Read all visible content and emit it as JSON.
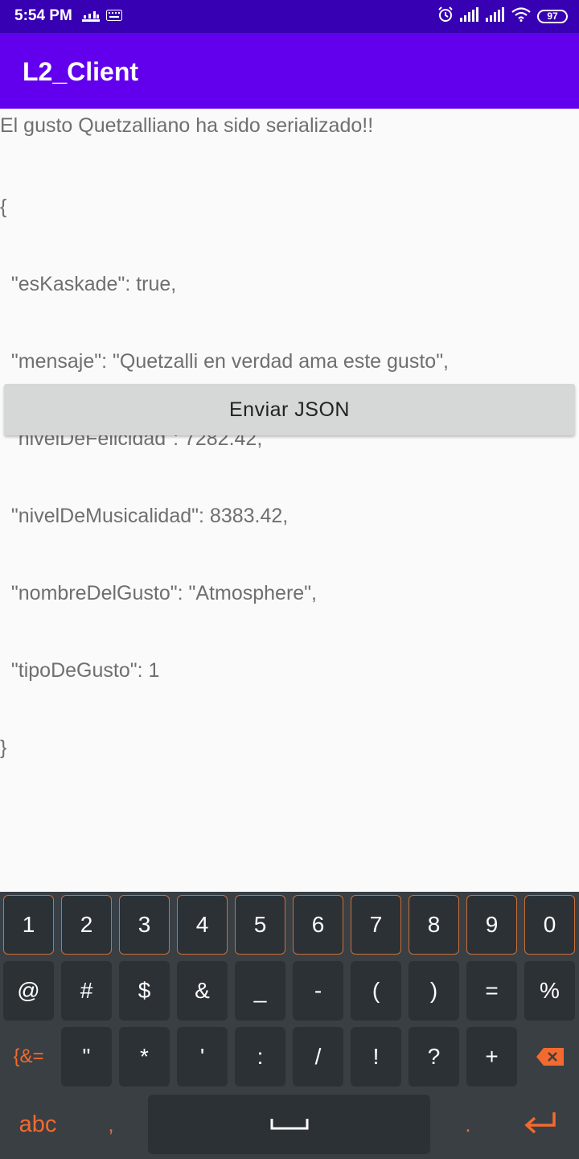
{
  "status_bar": {
    "time": "5:54 PM",
    "battery": "97",
    "icons": [
      "notification-icon",
      "keyboard-icon",
      "alarm-icon",
      "signal-icon",
      "signal-icon",
      "wifi-icon",
      "battery-icon"
    ]
  },
  "app_bar": {
    "title": "L2_Client"
  },
  "content": {
    "message": "El gusto Quetzalliano ha sido serializado!!",
    "json_lines": [
      "{",
      "  \"esKaskade\": true,",
      "  \"mensaje\": \"Quetzalli en verdad ama este gusto\",",
      "  \"nivelDeFelicidad\": 7282.42,",
      "  \"nivelDeMusicalidad\": 8383.42,",
      "  \"nombreDelGusto\": \"Atmosphere\",",
      "  \"tipoDeGusto\": 1",
      "}"
    ],
    "send_button": "Enviar JSON"
  },
  "keyboard": {
    "row1": [
      "1",
      "2",
      "3",
      "4",
      "5",
      "6",
      "7",
      "8",
      "9",
      "0"
    ],
    "row2": [
      "@",
      "#",
      "$",
      "&",
      "_",
      "-",
      "(",
      ")",
      "=",
      "%"
    ],
    "row3": [
      "{&=",
      "\"",
      "*",
      "'",
      ":",
      "/",
      "!",
      "?",
      "+"
    ],
    "row4": {
      "abc": "abc",
      "comma": ",",
      "period": "."
    },
    "accent_color": "#f26a2e"
  }
}
